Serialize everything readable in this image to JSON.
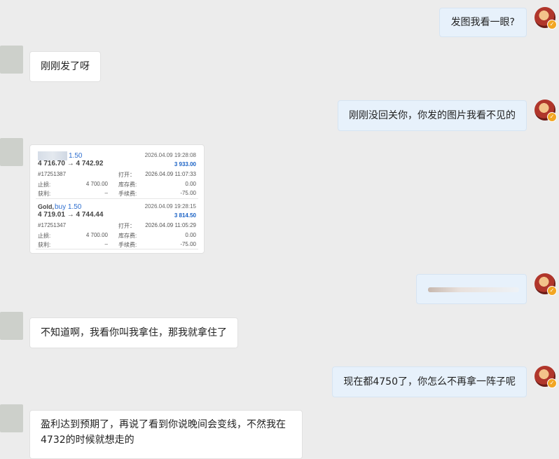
{
  "messages": {
    "m1": "发图我看一眼?",
    "m2": "刚刚发了呀",
    "m3": "刚刚没回关你，你发的图片我看不见的",
    "m5": "不知道啊，我看你叫我拿住，那我就拿住了",
    "m6": "现在都4750了，你怎么不再拿一阵子呢",
    "m7": "盈利达到预期了，再说了看到你说晚间会变线，不然我在4732的时候就想走的"
  },
  "trades": [
    {
      "symbol": "",
      "action": "1.50",
      "prices": "4 716.70 → 4 742.92",
      "close_time": "2026.04.09 19:28:08",
      "profit": "3 933.00",
      "ticket": "#17251387",
      "open_label": "打开：",
      "open_time": "2026.04.09 11:07:33",
      "sl_label": "止损:",
      "sl_value": "4 700.00",
      "swap_label": "库存费:",
      "swap_value": "0.00",
      "tp_label": "获利:",
      "tp_value": "–",
      "fee_label": "手续费:",
      "fee_value": "-75.00"
    },
    {
      "symbol": "Gold,",
      "action": "buy 1.50",
      "prices": "4 719.01 → 4 744.44",
      "close_time": "2026.04.09 19:28:15",
      "profit": "3 814.50",
      "ticket": "#17251347",
      "open_label": "打开：",
      "open_time": "2026.04.09 11:05:29",
      "sl_label": "止损:",
      "sl_value": "4 700.00",
      "swap_label": "库存费:",
      "swap_value": "0.00",
      "tp_label": "获利:",
      "tp_value": "–",
      "fee_label": "手续费:",
      "fee_value": "-75.00"
    }
  ],
  "badge_icon": "verified-badge-icon",
  "colors": {
    "right_bubble": "#e7f1fb",
    "profit_blue": "#1a62c5",
    "badge": "#f2a623"
  }
}
